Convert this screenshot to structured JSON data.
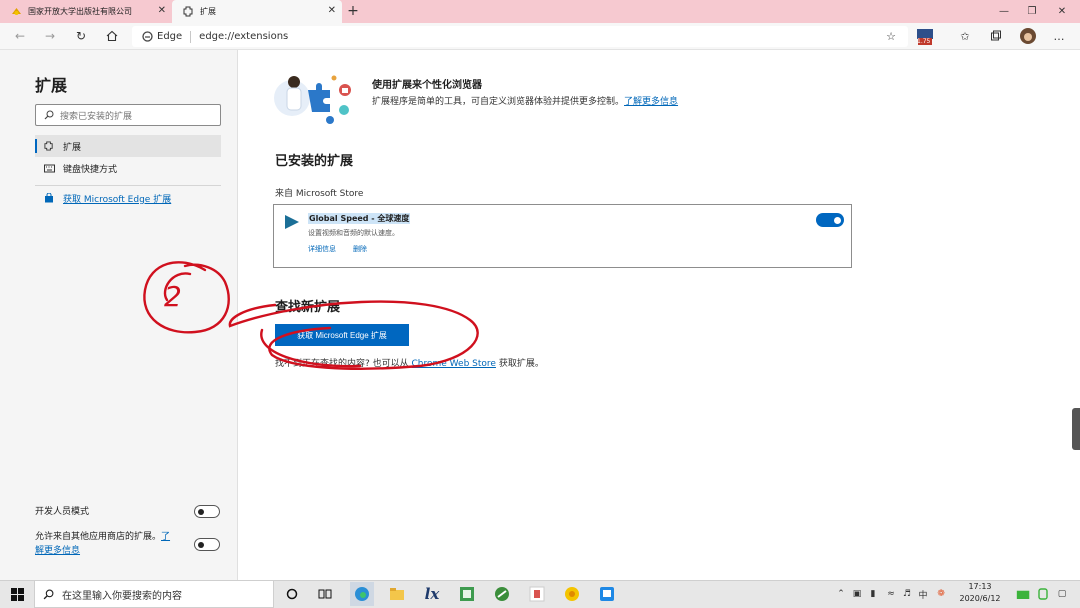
{
  "tabs": [
    {
      "title": "国家开放大学出版社有限公司",
      "close": "✕"
    },
    {
      "title": "扩展",
      "close": "✕"
    }
  ],
  "new_tab": "+",
  "window_controls": {
    "minimize": "—",
    "maximize": "❐",
    "close": "✕"
  },
  "address": {
    "site_label": "Edge",
    "url": "edge://extensions"
  },
  "toolbar_badge": "1.75",
  "sidebar": {
    "title": "扩展",
    "search_placeholder": "搜索已安装的扩展",
    "items": [
      {
        "label": "扩展"
      },
      {
        "label": "键盘快捷方式"
      }
    ],
    "get_link": "获取 Microsoft Edge 扩展",
    "dev_mode_label": "开发人员模式",
    "other_stores_label": "允许来自其他应用商店的扩展。",
    "other_stores_link_1": "了",
    "other_stores_link_2": "解更多信息"
  },
  "hero": {
    "title": "使用扩展来个性化浏览器",
    "desc": "扩展程序是简单的工具，可自定义浏览器体验并提供更多控制。",
    "learn_more": "了解更多信息"
  },
  "installed": {
    "heading": "已安装的扩展",
    "source": "来自 Microsoft Store",
    "extension": {
      "name": "Global Speed - 全球速度",
      "desc": "设置视频和音频的默认速度。",
      "details": "详细信息",
      "remove": "删除",
      "enabled": true
    }
  },
  "find": {
    "heading": "查找新扩展",
    "button": "获取 Microsoft Edge 扩展",
    "alt_prefix": "找不到正在查找的内容? 也可以从",
    "alt_link": "Chrome Web Store",
    "alt_suffix": "获取扩展。"
  },
  "annotation_number": "2",
  "taskbar": {
    "search_placeholder": "在这里输入你要搜索的内容",
    "tray_ime": "中",
    "time": "17:13",
    "date": "2020/6/12"
  },
  "colors": {
    "accent": "#0067c0",
    "tab_strip": "#f6c9d0",
    "annotation": "#d0101e"
  }
}
